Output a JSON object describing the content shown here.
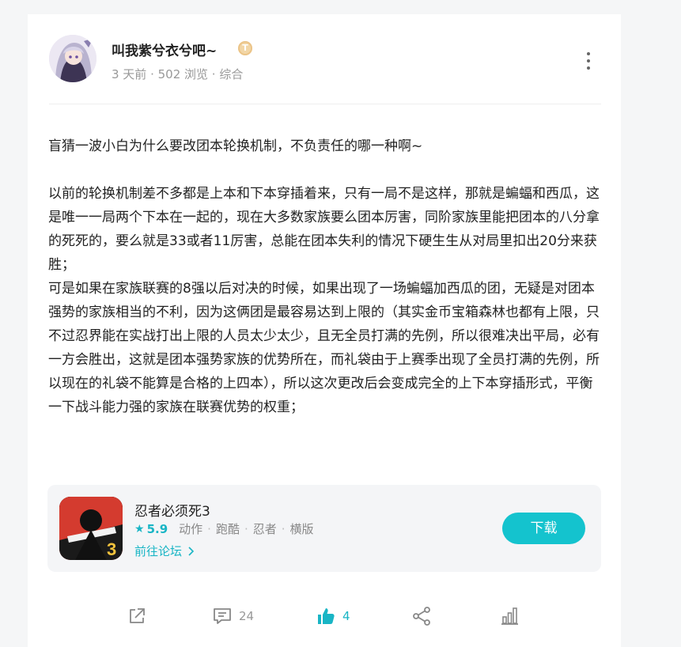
{
  "author": {
    "name": "叫我紫兮衣兮吧~",
    "level_badge": "T",
    "meta": "3 天前 · 502 浏览 · 综合"
  },
  "post": {
    "paragraphs": [
      "盲猜一波小白为什么要改团本轮换机制，不负责任的哪一种啊~",
      "以前的轮换机制差不多都是上本和下本穿插着来，只有一局不是这样，那就是蝙蝠和西瓜，这是唯一一局两个下本在一起的，现在大多数家族要么团本厉害，同阶家族里能把团本的八分拿的死死的，要么就是33或者11厉害，总能在团本失利的情况下硬生生从对局里扣出20分来获胜；",
      "可是如果在家族联赛的8强以后对决的时候，如果出现了一场蝙蝠加西瓜的团，无疑是对团本强势的家族相当的不利，因为这俩团是最容易达到上限的（其实金币宝箱森林也都有上限，只不过忍界能在实战打出上限的人员太少太少，且无全员打满的先例，所以很难决出平局，必有一方会胜出，这就是团本强势家族的优势所在，而礼袋由于上赛季出现了全员打满的先例，所以现在的礼袋不能算是合格的上四本），所以这次更改后会变成完全的上下本穿插形式，平衡一下战斗能力强的家族在联赛优势的权重；"
    ]
  },
  "game": {
    "name": "忍者必须死3",
    "rating": "5.9",
    "tags": [
      "动作",
      "跑酷",
      "忍者",
      "横版"
    ],
    "forum_link": "前往论坛",
    "download_label": "下载",
    "icon_number": "3"
  },
  "actions": {
    "comment_count": "24",
    "like_count": "4"
  },
  "colors": {
    "accent": "#14c3ce",
    "text": "#222222",
    "muted": "#999999"
  }
}
